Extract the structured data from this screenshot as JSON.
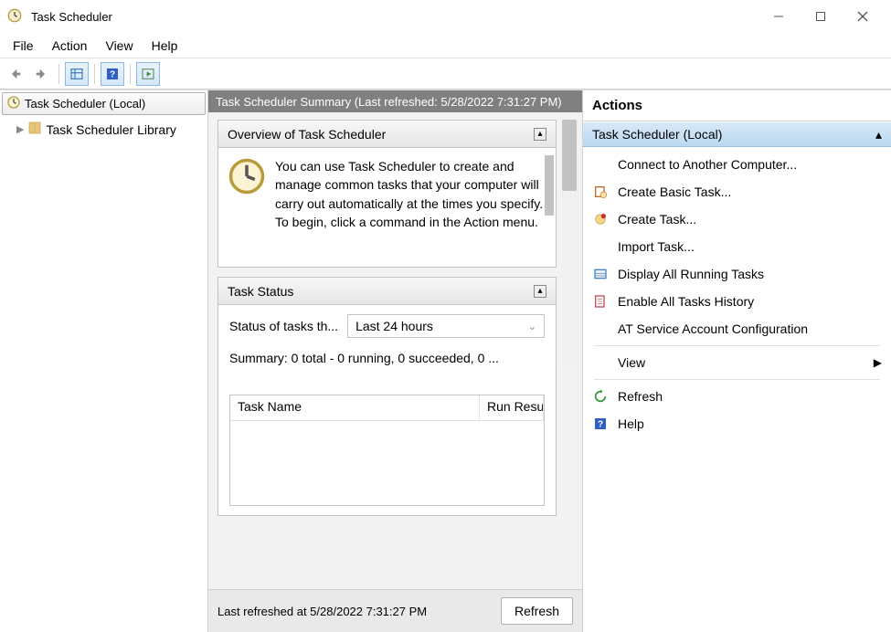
{
  "window": {
    "title": "Task Scheduler"
  },
  "menu": {
    "items": [
      "File",
      "Action",
      "View",
      "Help"
    ]
  },
  "tree": {
    "root": "Task Scheduler (Local)",
    "child": "Task Scheduler Library"
  },
  "summary": {
    "header": "Task Scheduler Summary (Last refreshed: 5/28/2022 7:31:27 PM)",
    "overview_title": "Overview of Task Scheduler",
    "overview_text": "You can use Task Scheduler to create and manage common tasks that your computer will carry out automatically at the times you specify. To begin, click a command in the Action menu.",
    "task_status_title": "Task Status",
    "status_label": "Status of tasks th...",
    "status_select_value": "Last 24 hours",
    "status_summary": "Summary: 0 total - 0 running, 0 succeeded, 0 ...",
    "table": {
      "col_name": "Task Name",
      "col_run": "Run Resu"
    },
    "footer_text": "Last refreshed at 5/28/2022 7:31:27 PM",
    "refresh_label": "Refresh"
  },
  "actions": {
    "panel_title": "Actions",
    "header": "Task Scheduler (Local)",
    "items": [
      {
        "label": "Connect to Another Computer...",
        "icon": "none"
      },
      {
        "label": "Create Basic Task...",
        "icon": "basic-task"
      },
      {
        "label": "Create Task...",
        "icon": "create-task"
      },
      {
        "label": "Import Task...",
        "icon": "none"
      },
      {
        "label": "Display All Running Tasks",
        "icon": "display-tasks"
      },
      {
        "label": "Enable All Tasks History",
        "icon": "history"
      },
      {
        "label": "AT Service Account Configuration",
        "icon": "none"
      }
    ],
    "view_label": "View",
    "refresh_label": "Refresh",
    "help_label": "Help"
  }
}
